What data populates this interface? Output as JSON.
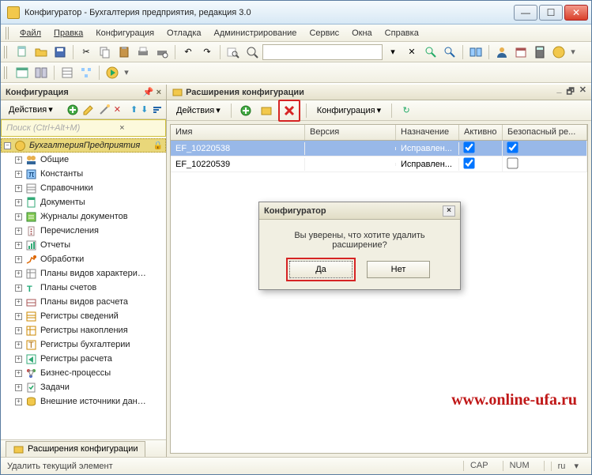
{
  "window": {
    "title": "Конфигуратор - Бухгалтерия предприятия, редакция 3.0"
  },
  "menu": {
    "items": [
      "Файл",
      "Правка",
      "Конфигурация",
      "Отладка",
      "Администрирование",
      "Сервис",
      "Окна",
      "Справка"
    ]
  },
  "toolbar2_search_placeholder": "",
  "left_panel": {
    "title": "Конфигурация",
    "actions_label": "Действия",
    "search_placeholder": "Поиск (Ctrl+Alt+M)",
    "root": "БухгалтерияПредприятия",
    "items": [
      "Общие",
      "Константы",
      "Справочники",
      "Документы",
      "Журналы документов",
      "Перечисления",
      "Отчеты",
      "Обработки",
      "Планы видов характери…",
      "Планы счетов",
      "Планы видов расчета",
      "Регистры сведений",
      "Регистры накопления",
      "Регистры бухгалтерии",
      "Регистры расчета",
      "Бизнес-процессы",
      "Задачи",
      "Внешние источники дан…"
    ]
  },
  "right_panel": {
    "title": "Расширения конфигурации",
    "actions_label": "Действия",
    "config_label": "Конфигурация",
    "columns": [
      "Имя",
      "Версия",
      "Назначение",
      "Активно",
      "Безопасный ре..."
    ],
    "rows": [
      {
        "name": "EF_10220538",
        "version": "",
        "purpose": "Исправлен...",
        "active": true,
        "safe": true
      },
      {
        "name": "EF_10220539",
        "version": "",
        "purpose": "Исправлен...",
        "active": true,
        "safe": false
      }
    ]
  },
  "dialog": {
    "title": "Конфигуратор",
    "message": "Вы уверены, что хотите удалить расширение?",
    "yes": "Да",
    "no": "Нет"
  },
  "bottom_tab": "Расширения конфигурации",
  "status": {
    "hint": "Удалить текущий элемент",
    "cap": "CAP",
    "num": "NUM",
    "lang": "ru"
  },
  "watermark": "www.online-ufa.ru"
}
